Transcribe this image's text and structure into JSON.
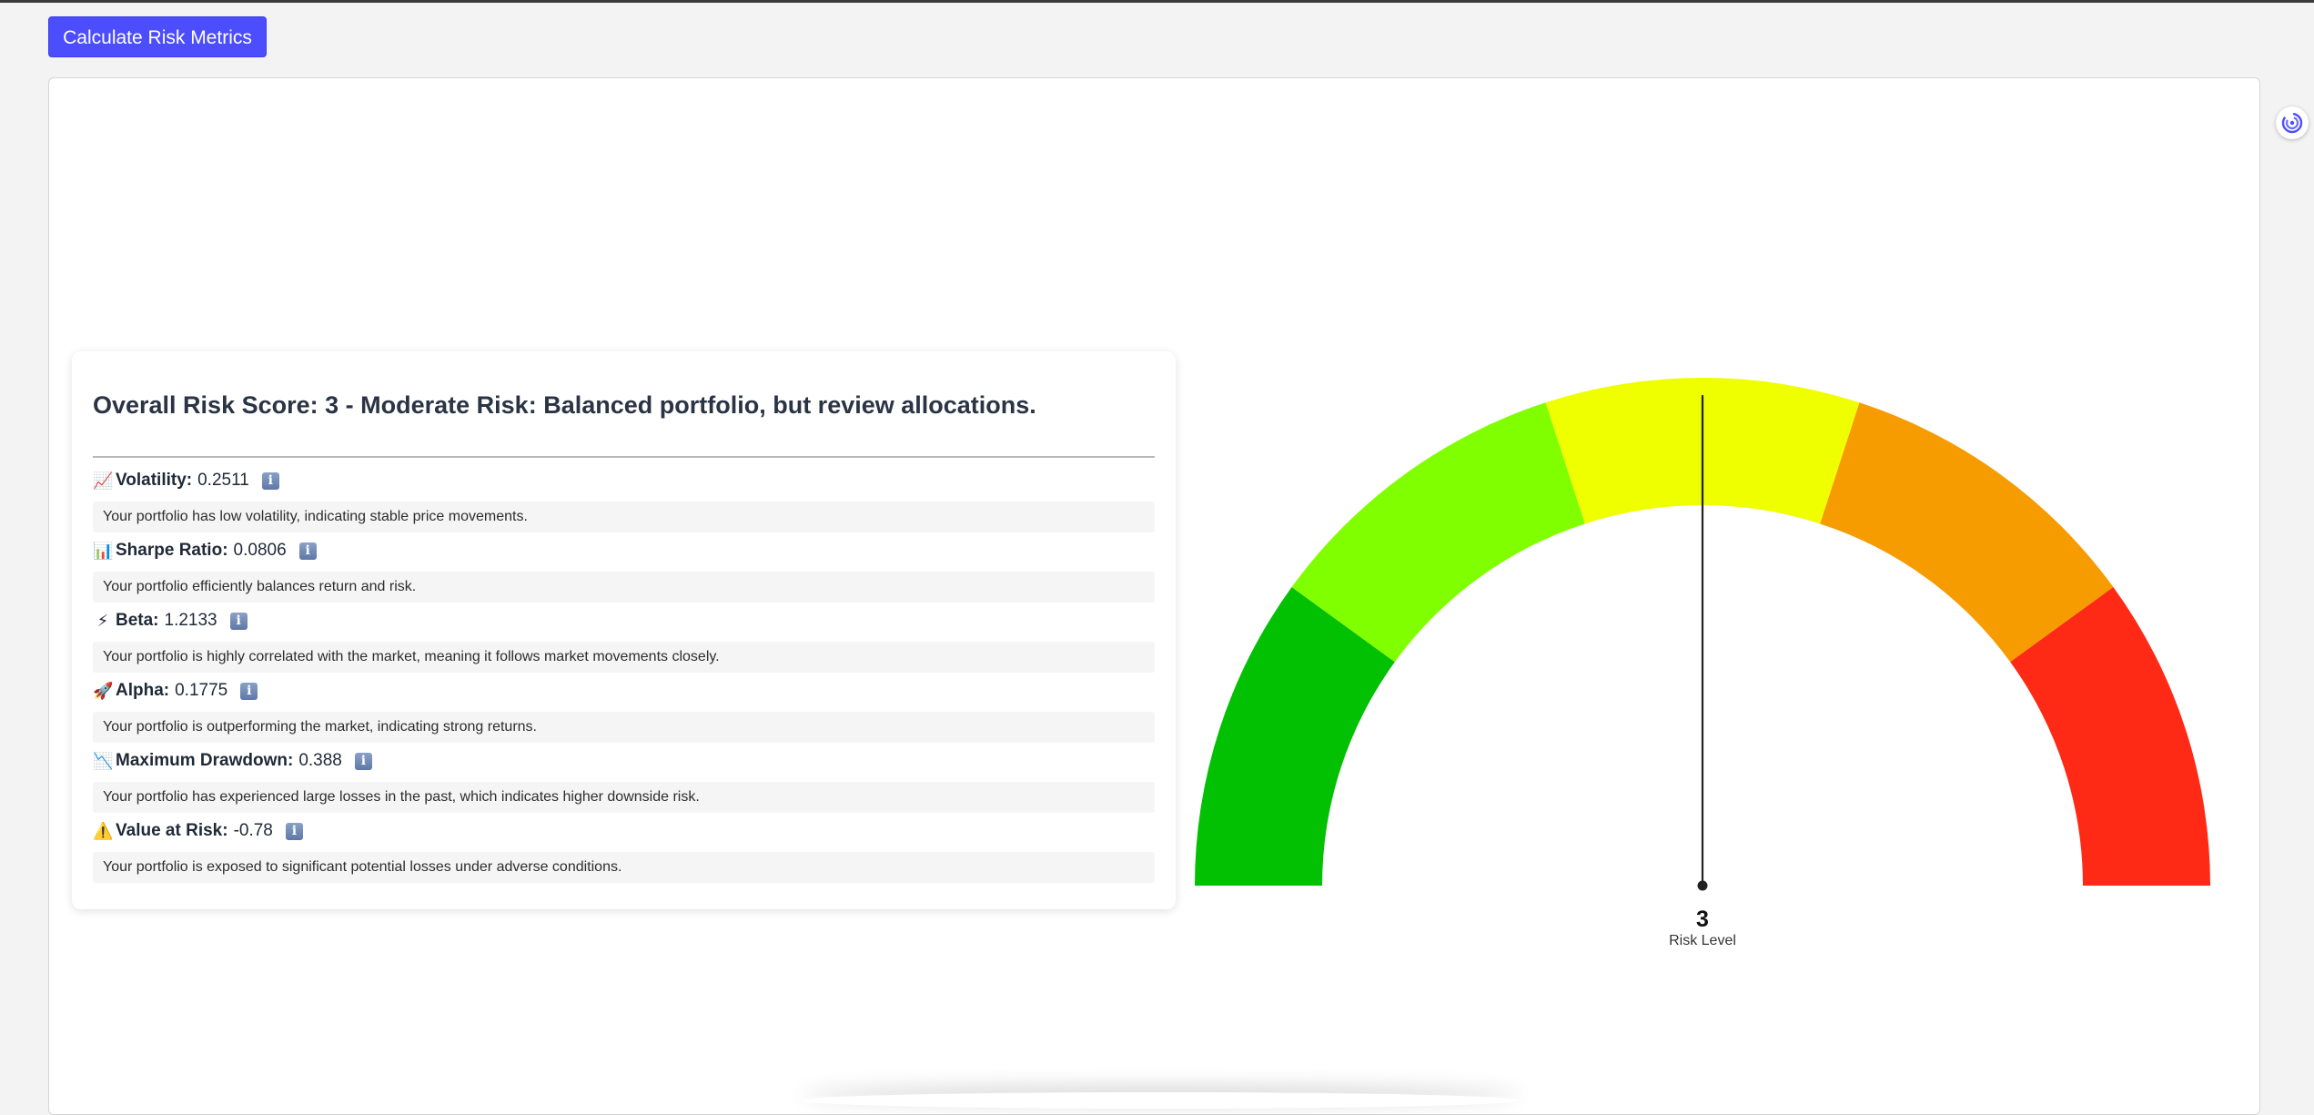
{
  "toolbar": {
    "calculate_label": "Calculate Risk Metrics"
  },
  "summary": {
    "title": "Overall Risk Score: 3 - Moderate Risk: Balanced portfolio, but review allocations."
  },
  "metrics": [
    {
      "emoji": "📈",
      "icon": "chart-increasing-icon",
      "name": "Volatility:",
      "value": "0.2511",
      "description": "Your portfolio has low volatility, indicating stable price movements."
    },
    {
      "emoji": "📊",
      "icon": "bar-chart-icon",
      "name": "Sharpe Ratio:",
      "value": "0.0806",
      "description": "Your portfolio efficiently balances return and risk."
    },
    {
      "emoji": "⚡",
      "icon": "lightning-icon",
      "name": "Beta:",
      "value": "1.2133",
      "description": "Your portfolio is highly correlated with the market, meaning it follows market movements closely."
    },
    {
      "emoji": "🚀",
      "icon": "rocket-icon",
      "name": "Alpha:",
      "value": "0.1775",
      "description": "Your portfolio is outperforming the market, indicating strong returns."
    },
    {
      "emoji": "📉",
      "icon": "chart-decreasing-icon",
      "name": "Maximum Drawdown:",
      "value": "0.388",
      "description": "Your portfolio has experienced large losses in the past, which indicates higher downside risk."
    },
    {
      "emoji": "⚠️",
      "icon": "warning-icon",
      "name": "Value at Risk:",
      "value": "-0.78",
      "description": "Your portfolio is exposed to significant potential losses under adverse conditions."
    }
  ],
  "info_glyph": "i",
  "gauge": {
    "value": 3,
    "value_text": "3",
    "label": "Risk Level",
    "min": 0,
    "max": 5,
    "segment_colors": [
      "#02c102",
      "#80ff00",
      "#efff00",
      "#f79c00",
      "#fe2a16"
    ],
    "needle_color": "#222222"
  },
  "colors": {
    "background": "#f3f3f3",
    "button": "#4c4dfd",
    "card_title": "#2b3445"
  },
  "side_icon": "swirl-icon"
}
